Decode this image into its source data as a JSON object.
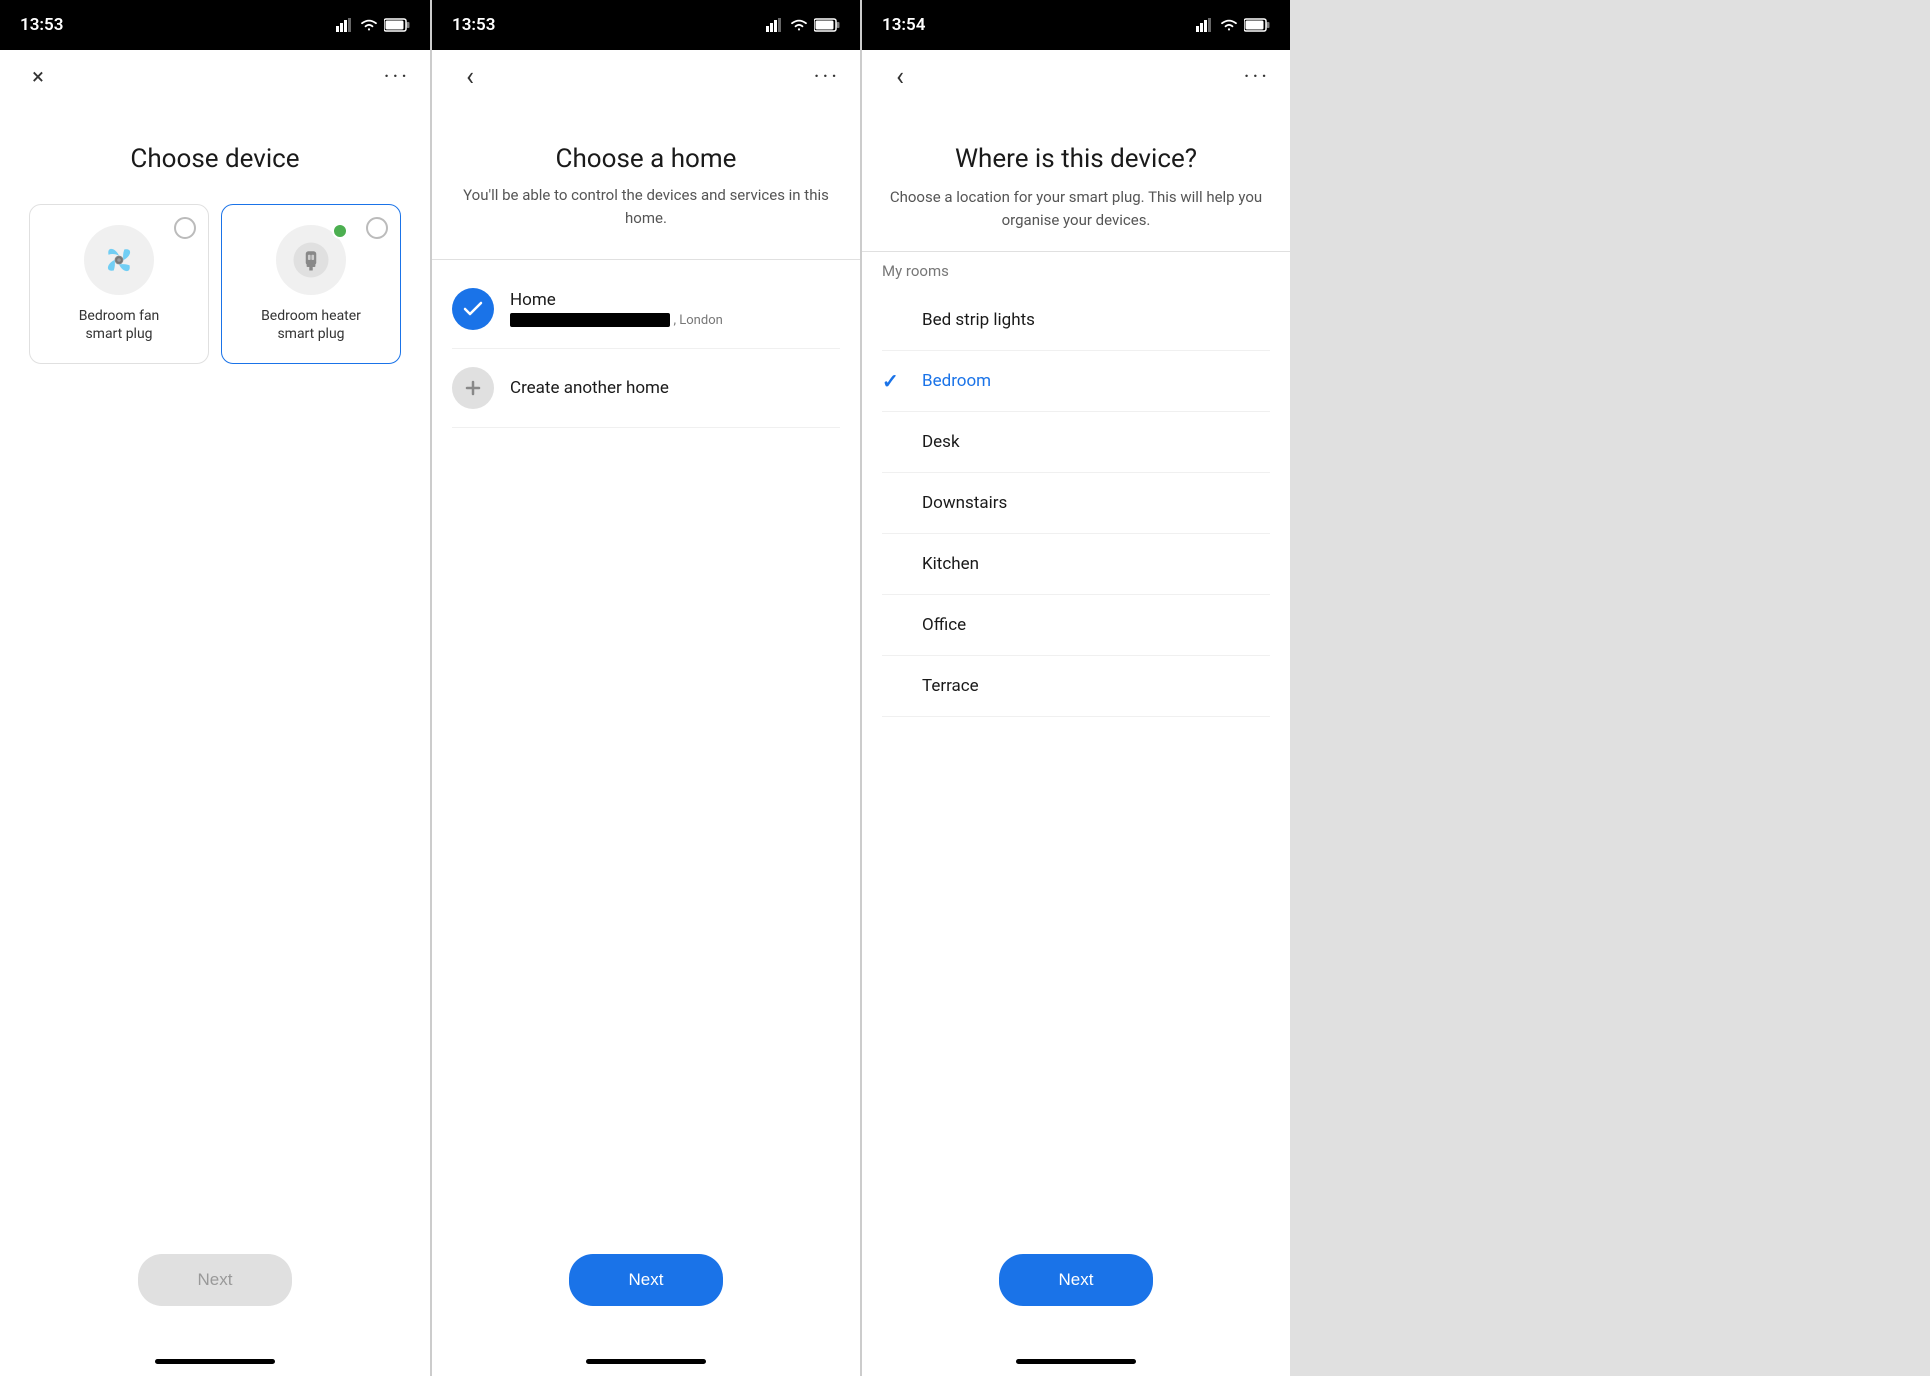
{
  "screens": [
    {
      "id": "choose-device",
      "statusTime": "13:53",
      "navLeftIcon": "×",
      "navRightIcon": "···",
      "title": "Choose device",
      "devices": [
        {
          "name": "Bedroom fan\nsmart plug",
          "iconType": "fan",
          "selected": false
        },
        {
          "name": "Bedroom heater\nsmart plug",
          "iconType": "plug",
          "selected": true
        }
      ],
      "nextLabel": "Next",
      "nextEnabled": false
    },
    {
      "id": "choose-home",
      "statusTime": "13:53",
      "navLeftIcon": "‹",
      "navRightIcon": "···",
      "title": "Choose a home",
      "subtitle": "You'll be able to control the devices and services in this home.",
      "homes": [
        {
          "type": "existing",
          "name": "Home",
          "address": ", London",
          "selected": true
        },
        {
          "type": "create",
          "name": "Create another home",
          "selected": false
        }
      ],
      "nextLabel": "Next",
      "nextEnabled": true
    },
    {
      "id": "where-device",
      "statusTime": "13:54",
      "navLeftIcon": "‹",
      "navRightIcon": "···",
      "title": "Where is this device?",
      "subtitle": "Choose a location for your smart plug. This will help you organise your devices.",
      "roomsSectionTitle": "My rooms",
      "rooms": [
        {
          "name": "Bed strip lights",
          "selected": false
        },
        {
          "name": "Bedroom",
          "selected": true
        },
        {
          "name": "Desk",
          "selected": false
        },
        {
          "name": "Downstairs",
          "selected": false
        },
        {
          "name": "Kitchen",
          "selected": false
        },
        {
          "name": "Office",
          "selected": false
        },
        {
          "name": "Terrace",
          "selected": false
        }
      ],
      "nextLabel": "Next",
      "nextEnabled": true
    }
  ]
}
